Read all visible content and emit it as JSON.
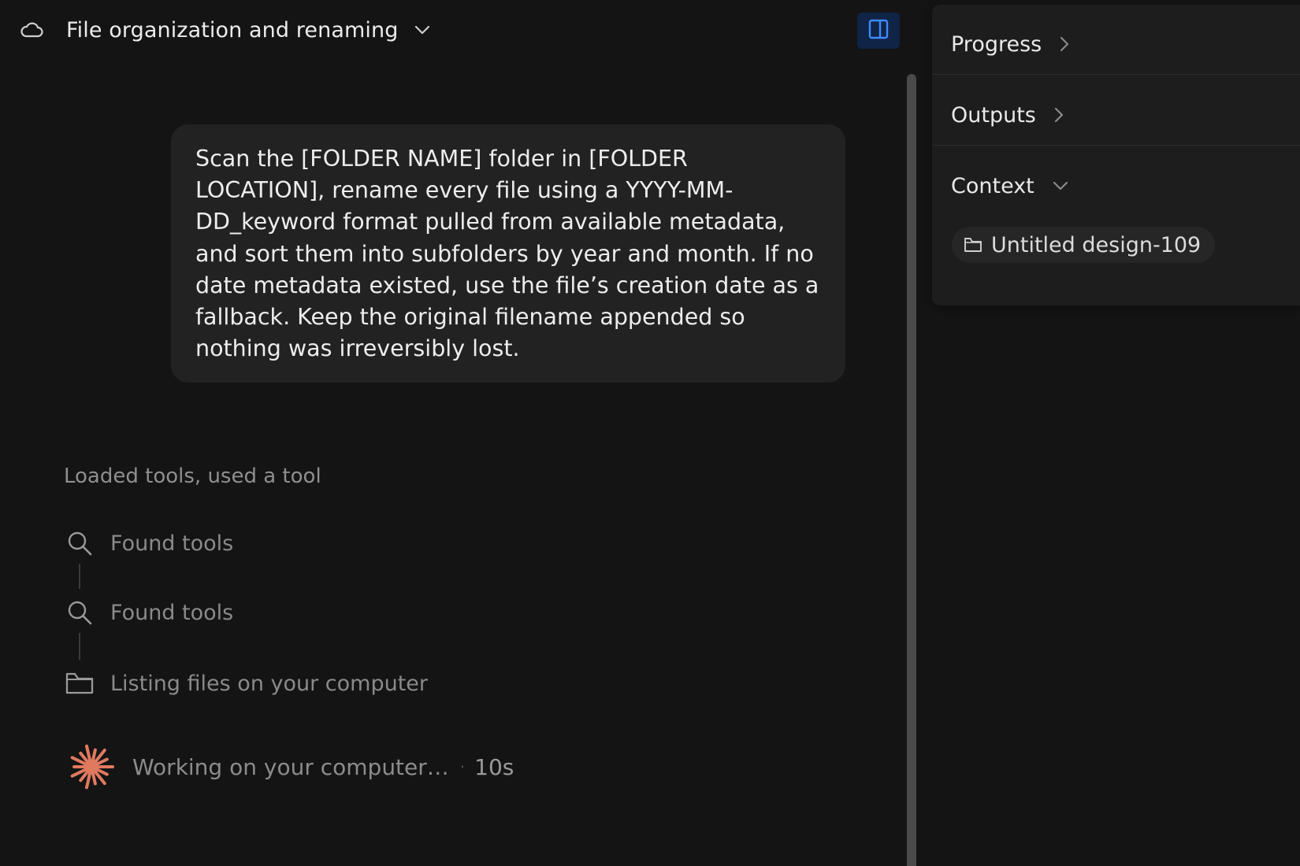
{
  "header": {
    "title": "File organization and renaming"
  },
  "prompt": {
    "text": "Scan the [FOLDER NAME] folder in [FOLDER LOCATION], rename every file using a YYYY-MM-DD_keyword format pulled from available metadata, and sort them into subfolders by year and month. If no date metadata existed, use the file’s creation date as a fallback. Keep the original filename appended so nothing was irreversibly lost."
  },
  "activity": {
    "summary": "Loaded tools, used a tool",
    "steps": [
      {
        "icon": "search-icon",
        "label": "Found tools"
      },
      {
        "icon": "search-icon",
        "label": "Found tools"
      },
      {
        "icon": "folder-icon",
        "label": "Listing files on your computer"
      }
    ],
    "working": {
      "label": "Working on your computer…",
      "separator": "·",
      "elapsed": "10s"
    }
  },
  "right_panel": {
    "sections": [
      {
        "label": "Progress",
        "state": "collapsed"
      },
      {
        "label": "Outputs",
        "state": "collapsed"
      },
      {
        "label": "Context",
        "state": "expanded"
      }
    ],
    "context_items": [
      {
        "icon": "folder-icon",
        "label": "Untitled design-109"
      }
    ]
  },
  "colors": {
    "background": "#141414",
    "bubble": "#222222",
    "panel": "#1d1d1d",
    "toggle_bg": "#0f2446",
    "toggle_icon": "#3d8bff",
    "accent_spark": "#e07a5f",
    "muted_text": "#8a8a8a"
  }
}
